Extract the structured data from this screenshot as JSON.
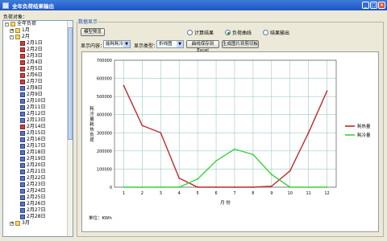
{
  "window": {
    "title": "全年负荷结果输出",
    "minimize": "_",
    "maximize": "□",
    "close": "×"
  },
  "left": {
    "label": "负荷对象：",
    "tree": [
      {
        "label": "全年负荷",
        "indent": 0,
        "icon": "folder",
        "expander": "-"
      },
      {
        "label": "1月",
        "indent": 1,
        "icon": "folder",
        "expander": "+"
      },
      {
        "label": "2月",
        "indent": 1,
        "icon": "folder",
        "expander": "-"
      },
      {
        "label": "2月1日",
        "indent": 2,
        "icon": "red"
      },
      {
        "label": "2月2日",
        "indent": 2,
        "icon": "red"
      },
      {
        "label": "2月3日",
        "indent": 2,
        "icon": "red"
      },
      {
        "label": "2月4日",
        "indent": 2,
        "icon": "red"
      },
      {
        "label": "2月5日",
        "indent": 2,
        "icon": "red"
      },
      {
        "label": "2月6日",
        "indent": 2,
        "icon": "red"
      },
      {
        "label": "2月7日",
        "indent": 2,
        "icon": "red"
      },
      {
        "label": "2月8日",
        "indent": 2,
        "icon": "blue"
      },
      {
        "label": "2月9日",
        "indent": 2,
        "icon": "blue"
      },
      {
        "label": "2月10日",
        "indent": 2,
        "icon": "blue"
      },
      {
        "label": "2月11日",
        "indent": 2,
        "icon": "blue"
      },
      {
        "label": "2月12日",
        "indent": 2,
        "icon": "blue"
      },
      {
        "label": "2月13日",
        "indent": 2,
        "icon": "blue"
      },
      {
        "label": "2月14日",
        "indent": 2,
        "icon": "red"
      },
      {
        "label": "2月15日",
        "indent": 2,
        "icon": "blue"
      },
      {
        "label": "2月16日",
        "indent": 2,
        "icon": "blue"
      },
      {
        "label": "2月17日",
        "indent": 2,
        "icon": "blue"
      },
      {
        "label": "2月18日",
        "indent": 2,
        "icon": "blue"
      },
      {
        "label": "2月19日",
        "indent": 2,
        "icon": "blue"
      },
      {
        "label": "2月20日",
        "indent": 2,
        "icon": "blue"
      },
      {
        "label": "2月21日",
        "indent": 2,
        "icon": "blue"
      },
      {
        "label": "2月22日",
        "indent": 2,
        "icon": "blue"
      },
      {
        "label": "2月23日",
        "indent": 2,
        "icon": "blue"
      },
      {
        "label": "2月24日",
        "indent": 2,
        "icon": "blue"
      },
      {
        "label": "2月25日",
        "indent": 2,
        "icon": "blue"
      },
      {
        "label": "2月26日",
        "indent": 2,
        "icon": "blue"
      },
      {
        "label": "2月27日",
        "indent": 2,
        "icon": "blue"
      },
      {
        "label": "2月28日",
        "indent": 2,
        "icon": "blue"
      },
      {
        "label": "3月",
        "indent": 1,
        "icon": "folder",
        "expander": "+"
      }
    ]
  },
  "display": {
    "group_title": "数据显示",
    "mode_button": "模型预览",
    "radios": [
      {
        "label": "计算结果",
        "selected": false
      },
      {
        "label": "负荷曲线",
        "selected": true
      },
      {
        "label": "结果输出",
        "selected": false
      }
    ],
    "content_label": "显示内容：",
    "content_value": "能耗耗冷",
    "type_label": "显示类型：",
    "type_value": "折线图",
    "save_button": "曲线保存到Excel",
    "copy_button": "生成图片到剪切板"
  },
  "chart_data": {
    "type": "line",
    "x": [
      1,
      2,
      3,
      4,
      5,
      6,
      7,
      8,
      9,
      10,
      11,
      12
    ],
    "xlabel": "月 份",
    "ylabel": "耗冷量耗热负荷",
    "unit_text": "单位：KWh",
    "ylim": [
      0,
      700000
    ],
    "yticks": [
      "0",
      "100000",
      "200000",
      "300000",
      "400000",
      "500000",
      "600000",
      "700000"
    ],
    "grid": true,
    "legend_position": "right",
    "series": [
      {
        "name": "耗热量",
        "color": "#c0282a",
        "values": [
          560000,
          340000,
          300000,
          50000,
          0,
          0,
          0,
          0,
          5000,
          90000,
          300000,
          530000
        ]
      },
      {
        "name": "耗冷量",
        "color": "#3ad23a",
        "values": [
          0,
          0,
          0,
          0,
          45000,
          145000,
          210000,
          180000,
          70000,
          0,
          0,
          0
        ]
      }
    ]
  }
}
